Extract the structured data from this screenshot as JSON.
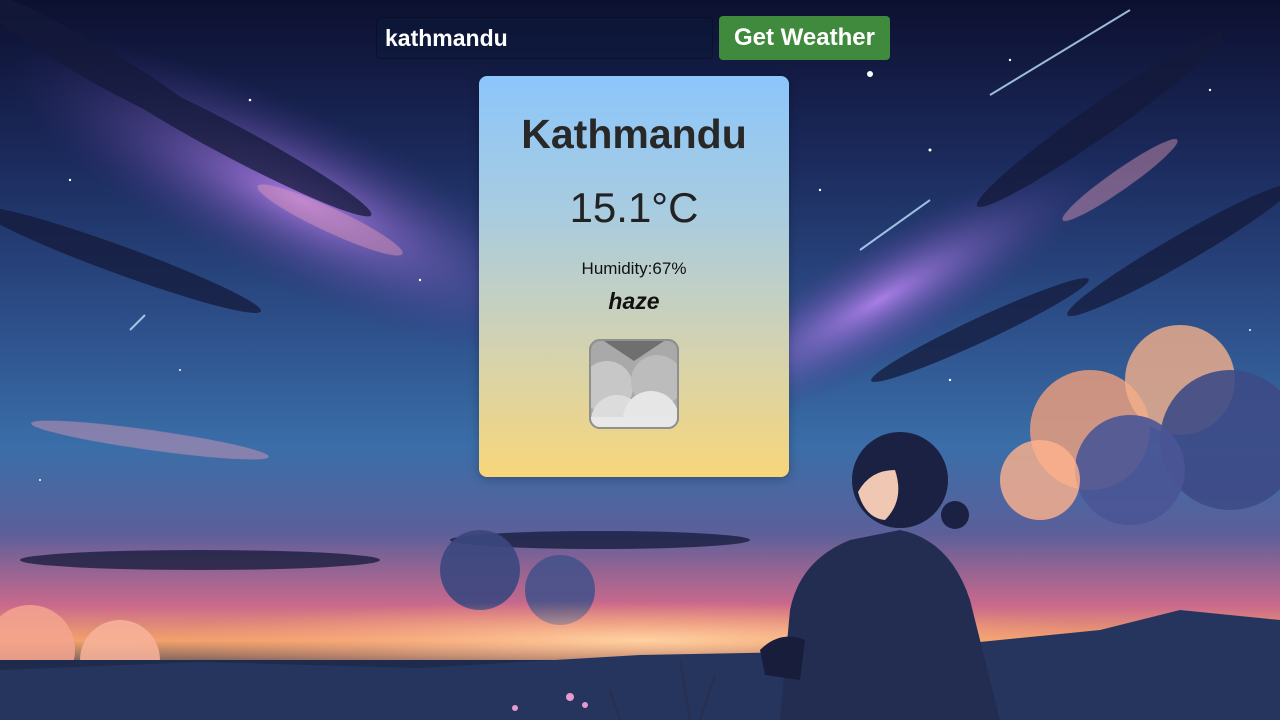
{
  "search": {
    "value": "kathmandu",
    "button_label": "Get Weather"
  },
  "weather": {
    "city": "Kathmandu",
    "temperature": "15.1°C",
    "humidity_label": "Humidity:",
    "humidity_value": "67%",
    "condition": "haze",
    "icon": "haze-cloud-icon"
  },
  "colors": {
    "button": "#3f8a3c",
    "card_top": "#8cc6fb",
    "card_bottom": "#f8d67a"
  }
}
